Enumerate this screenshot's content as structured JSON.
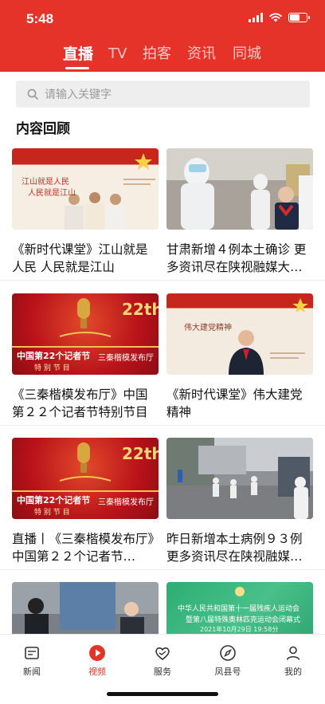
{
  "status_bar": {
    "time": "5:48"
  },
  "tabs": [
    {
      "label": "直播",
      "active": true
    },
    {
      "label": "TV",
      "active": false
    },
    {
      "label": "拍客",
      "active": false
    },
    {
      "label": "资讯",
      "active": false
    },
    {
      "label": "同城",
      "active": false
    }
  ],
  "search": {
    "placeholder": "请输入关键字"
  },
  "section": {
    "title": "内容回顾"
  },
  "items": [
    {
      "title": "《新时代课堂》江山就是人民 人民就是江山",
      "thumb_text": [
        "江山就是人民",
        "人民就是江山"
      ]
    },
    {
      "title": "甘肃新增４例本土确诊 更多资讯尽在陕视融媒大…"
    },
    {
      "title": "《三秦楷模发布厅》中国第２２个记者节特别节目",
      "thumb_text": [
        "22th",
        "中国第22个记者节",
        "三秦楷模发布厅",
        "特 别 节 目"
      ]
    },
    {
      "title": "《新时代课堂》伟大建党精神",
      "thumb_text": [
        "伟大建党精神"
      ]
    },
    {
      "title": "直播丨《三秦楷模发布厅》中国第２２个记者节…",
      "thumb_text": [
        "22th",
        "中国第22个记者节",
        "三秦楷模发布厅",
        "特 别 节 目"
      ]
    },
    {
      "title": "昨日新增本土病例９３例 更多资讯尽在陕视融媒…"
    },
    {
      "title": ""
    },
    {
      "title": "",
      "thumb_text": [
        "中华人民共和国第十一届残疾人运动会",
        "暨第八届特殊奥林匹克运动会闭幕式",
        "2021年10月29日 19:58分"
      ]
    }
  ],
  "bottom_nav": [
    {
      "label": "新闻",
      "icon": "news-icon",
      "active": false
    },
    {
      "label": "视频",
      "icon": "video-play-icon",
      "active": true
    },
    {
      "label": "服务",
      "icon": "service-heart-icon",
      "active": false
    },
    {
      "label": "凤县号",
      "icon": "compass-icon",
      "active": false
    },
    {
      "label": "我的",
      "icon": "profile-icon",
      "active": false
    }
  ],
  "colors": {
    "brand_red": "#e5332a",
    "text": "#111111",
    "placeholder": "#9a9a9a"
  }
}
